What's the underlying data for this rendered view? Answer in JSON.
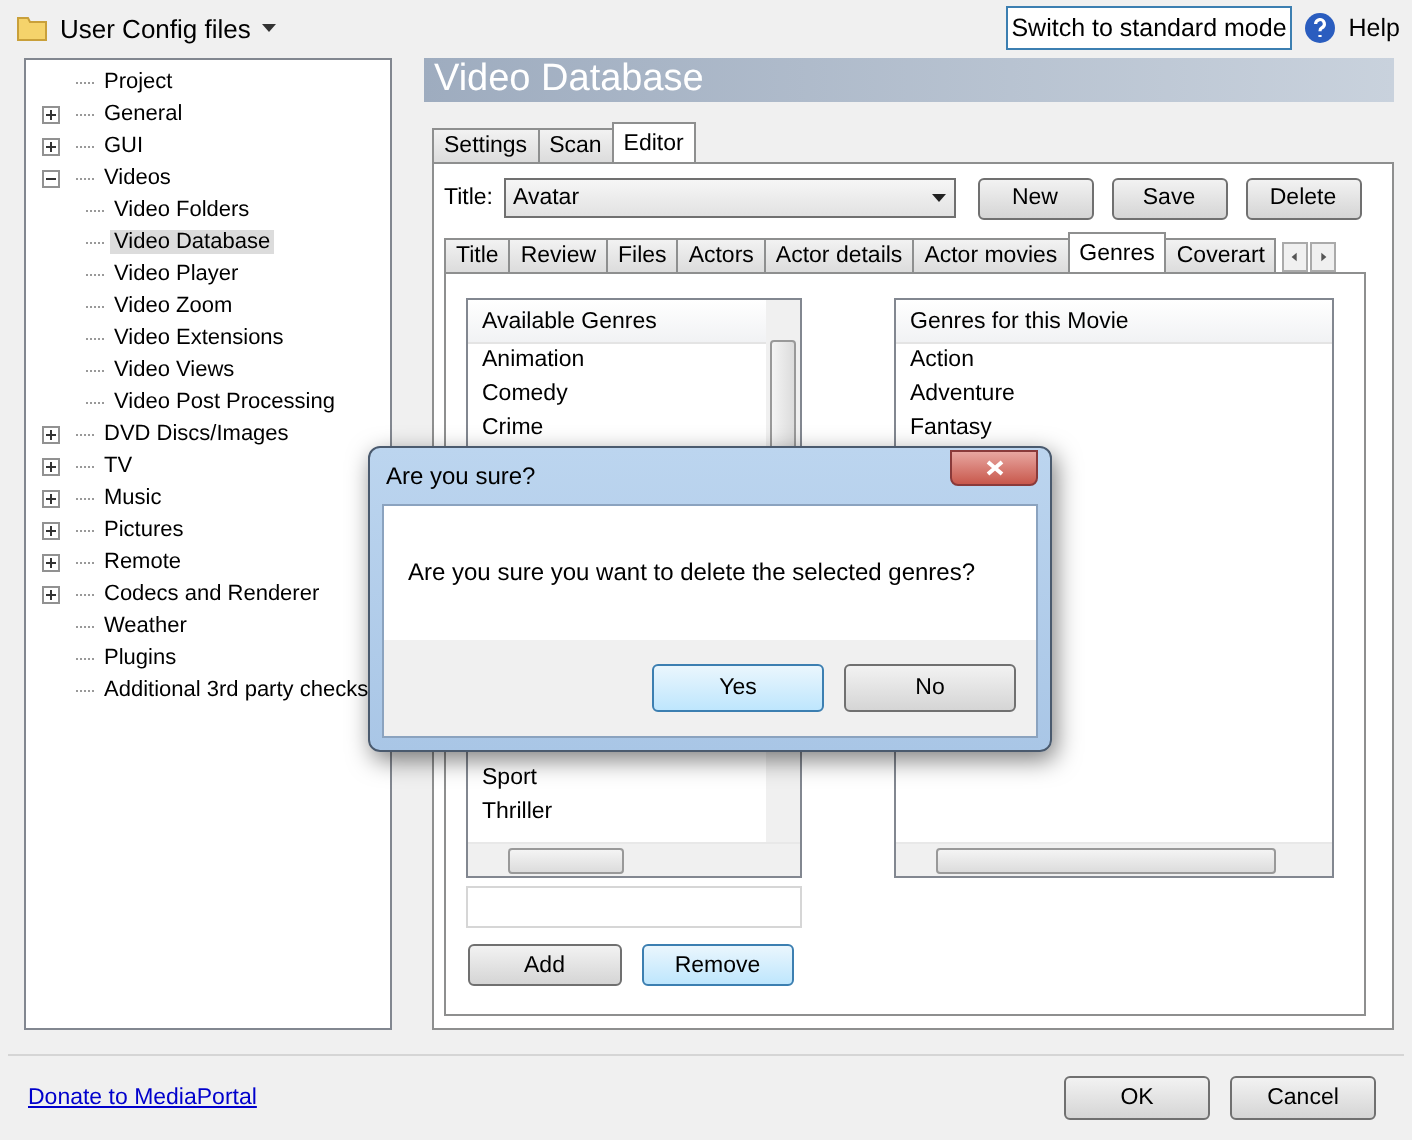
{
  "toolbar": {
    "title": "User Config files",
    "mode_button": "Switch to standard mode",
    "help": "Help"
  },
  "tree": [
    {
      "label": "Project",
      "selected": false
    },
    {
      "label": "General",
      "selected": false,
      "expanded": false
    },
    {
      "label": "GUI",
      "selected": false,
      "expanded": false
    },
    {
      "label": "Videos",
      "selected": false,
      "expanded": true,
      "children": [
        {
          "label": "Video Folders",
          "selected": false
        },
        {
          "label": "Video Database",
          "selected": true
        },
        {
          "label": "Video Player",
          "selected": false
        },
        {
          "label": "Video Zoom",
          "selected": false
        },
        {
          "label": "Video Extensions",
          "selected": false
        },
        {
          "label": "Video Views",
          "selected": false
        },
        {
          "label": "Video Post Processing",
          "selected": false
        }
      ]
    },
    {
      "label": "DVD Discs/Images",
      "selected": false,
      "expanded": false
    },
    {
      "label": "TV",
      "selected": false,
      "expanded": false
    },
    {
      "label": "Music",
      "selected": false,
      "expanded": false
    },
    {
      "label": "Pictures",
      "selected": false,
      "expanded": false
    },
    {
      "label": "Remote",
      "selected": false,
      "expanded": false
    },
    {
      "label": "Codecs and Renderer",
      "selected": false,
      "expanded": false
    },
    {
      "label": "Weather",
      "selected": false
    },
    {
      "label": "Plugins",
      "selected": false
    },
    {
      "label": "Additional 3rd party checks",
      "selected": false
    }
  ],
  "section_title": "Video Database",
  "tabs": [
    {
      "label": "Settings",
      "selected": false
    },
    {
      "label": "Scan",
      "selected": false
    },
    {
      "label": "Editor",
      "selected": true
    }
  ],
  "title_field": {
    "label": "Title:",
    "value": "Avatar"
  },
  "editor_buttons": [
    "New",
    "Save",
    "Delete"
  ],
  "inner_tabs": [
    {
      "label": "Title",
      "selected": false
    },
    {
      "label": "Review",
      "selected": false
    },
    {
      "label": "Files",
      "selected": false
    },
    {
      "label": "Actors",
      "selected": false
    },
    {
      "label": "Actor details",
      "selected": false
    },
    {
      "label": "Actor movies",
      "selected": false
    },
    {
      "label": "Genres",
      "selected": true
    },
    {
      "label": "Coverart",
      "selected": false
    }
  ],
  "available_genres": {
    "header": "Available Genres",
    "top_items": [
      "Animation",
      "Comedy",
      "Crime"
    ],
    "bottom_items": [
      "Sport",
      "Thriller"
    ]
  },
  "movie_genres": {
    "header": "Genres for this Movie",
    "items": [
      "Action",
      "Adventure",
      "Fantasy"
    ]
  },
  "list_buttons": [
    {
      "label": "Add",
      "focused": false
    },
    {
      "label": "Remove",
      "focused": true
    }
  ],
  "dialog": {
    "title": "Are you sure?",
    "message": "Are you sure you want to delete the selected genres?",
    "buttons": [
      {
        "label": "Yes",
        "focused": true
      },
      {
        "label": "No",
        "focused": false
      }
    ]
  },
  "footer": {
    "link": "Donate to MediaPortal",
    "buttons": [
      "OK",
      "Cancel"
    ]
  }
}
